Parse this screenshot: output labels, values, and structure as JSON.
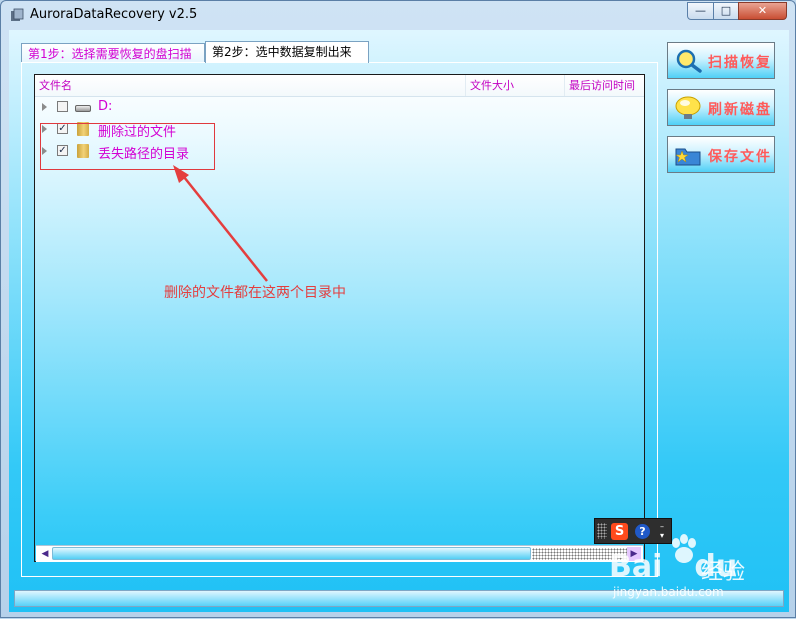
{
  "window": {
    "title": "AuroraDataRecovery v2.5"
  },
  "title_buttons": {
    "minimize": "—",
    "maximize": "□",
    "close": "✕"
  },
  "tabs": [
    {
      "label": "第1步：选择需要恢复的盘扫描",
      "active": false
    },
    {
      "label": "第2步：选中数据复制出来",
      "active": true
    }
  ],
  "file_list": {
    "columns": [
      "文件名",
      "文件大小",
      "最后访问时间"
    ],
    "rows": [
      {
        "label": "D:",
        "checked": false,
        "icon": "drive-icon"
      },
      {
        "label": "删除过的文件",
        "checked": true,
        "icon": "folder-icon"
      },
      {
        "label": "丢失路径的目录",
        "checked": true,
        "icon": "folder-icon"
      }
    ]
  },
  "annotation": {
    "text": "删除的文件都在这两个目录中",
    "color": "#e43e3e"
  },
  "buttons": [
    {
      "label": "扫描恢复",
      "icon": "magnifier-icon"
    },
    {
      "label": "刷新磁盘",
      "icon": "bulb-icon"
    },
    {
      "label": "保存文件",
      "icon": "folder-star-icon"
    }
  ],
  "ime_toolbar": {
    "logo": "S",
    "help": "?"
  },
  "watermark": {
    "logo": "Bai",
    "logo_tail": "du",
    "suffix": "经验",
    "url": "jingyan.baidu.com"
  },
  "colors": {
    "accent_magenta": "#d300d3",
    "button_text": "#ff5a5a",
    "background_cyan": "#33c9f7"
  }
}
